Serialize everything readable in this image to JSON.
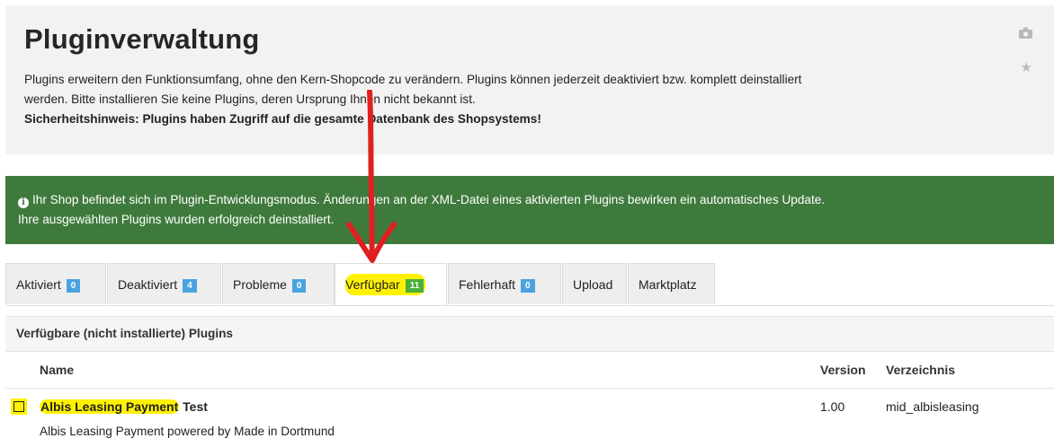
{
  "header": {
    "title": "Pluginverwaltung",
    "desc_line1": "Plugins erweitern den Funktionsumfang, ohne den Kern-Shopcode zu verändern. Plugins können jederzeit deaktiviert bzw. komplett deinstalliert",
    "desc_line2": "werden. Bitte installieren Sie keine Plugins, deren Ursprung Ihnen nicht bekannt ist.",
    "security_note": "Sicherheitshinweis: Plugins haben Zugriff auf die gesamte Datenbank des Shopsystems!",
    "icons": [
      "camera-icon",
      "star-icon"
    ]
  },
  "alert": {
    "line1": "Ihr Shop befindet sich im Plugin-Entwicklungsmodus. Änderungen an der XML-Datei eines aktivierten Plugins bewirken ein automatisches Update.",
    "line2": "Ihre ausgewählten Plugins wurden erfolgreich deinstalliert."
  },
  "tabs": [
    {
      "label": "Aktiviert",
      "count": "0"
    },
    {
      "label": "Deaktiviert",
      "count": "4"
    },
    {
      "label": "Probleme",
      "count": "0"
    },
    {
      "label": "Verfügbar",
      "count": "11"
    },
    {
      "label": "Fehlerhaft",
      "count": "0"
    },
    {
      "label": "Upload"
    },
    {
      "label": "Marktplatz"
    }
  ],
  "panel": {
    "title": "Verfügbare (nicht installierte) Plugins",
    "columns": {
      "name": "Name",
      "version": "Version",
      "directory": "Verzeichnis"
    },
    "rows": [
      {
        "name_highlight": "Albis Leasing Payment",
        "name_rest": " Test",
        "description": "Albis Leasing Payment powered by Made in Dortmund",
        "version": "1.00",
        "directory": "mid_albisleasing"
      }
    ]
  },
  "colors": {
    "alert_bg": "#3f7a3d",
    "badge_blue": "#4aa3df",
    "badge_green": "#4bae3a",
    "highlight": "#fff200",
    "annotation_arrow": "#e02020"
  }
}
